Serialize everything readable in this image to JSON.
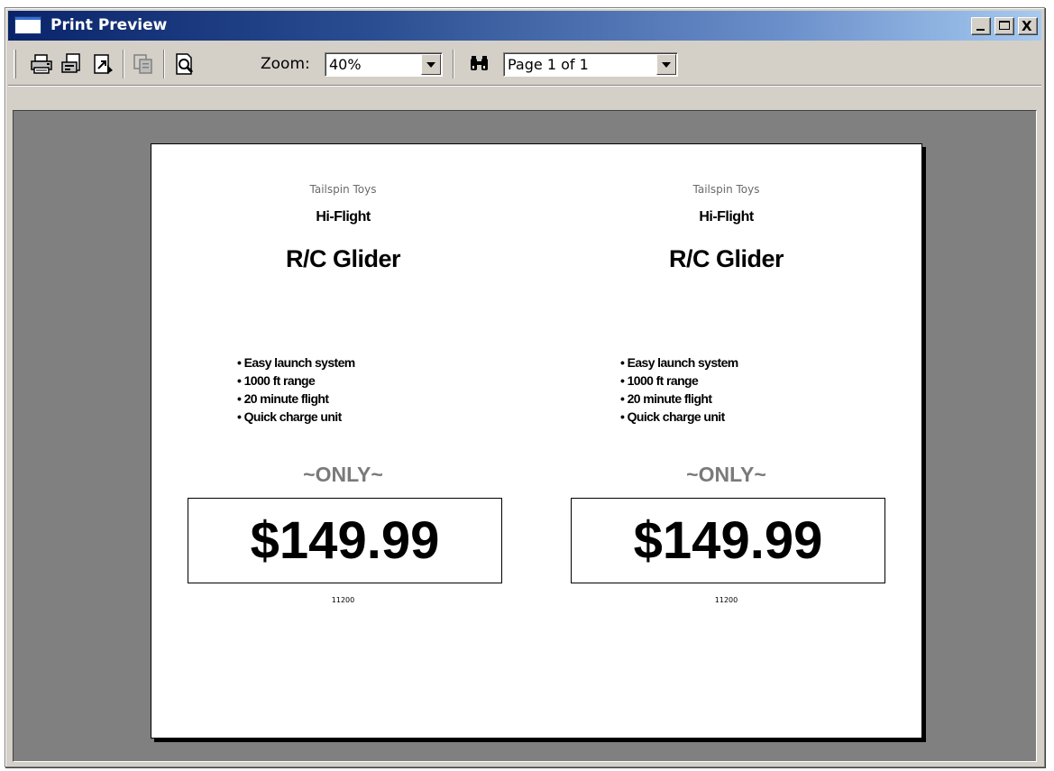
{
  "window": {
    "title": "Print Preview",
    "buttons": {
      "minimize": "_",
      "maximize": "□",
      "close": "X"
    }
  },
  "toolbar": {
    "icons": [
      "printer-icon",
      "page-setup-icon",
      "export-icon",
      "copy-icon",
      "preview-icon",
      "find-icon"
    ],
    "zoom_label": "Zoom:",
    "zoom_value": "40%",
    "page_value": "Page 1 of 1"
  },
  "page": {
    "signs": [
      {
        "brand": "Tailspin Toys",
        "product_line": "Hi-Flight",
        "product_name": "R/C Glider",
        "features": [
          "• Easy launch system",
          "• 1000 ft range",
          "• 20 minute flight",
          "• Quick charge unit"
        ],
        "only": "~ONLY~",
        "price": "$149.99",
        "code": "11200"
      },
      {
        "brand": "Tailspin Toys",
        "product_line": "Hi-Flight",
        "product_name": "R/C Glider",
        "features": [
          "• Easy launch system",
          "• 1000 ft range",
          "• 20 minute flight",
          "• Quick charge unit"
        ],
        "only": "~ONLY~",
        "price": "$149.99",
        "code": "11200"
      }
    ]
  },
  "colors": {
    "title_gradient_start": "#0a246a",
    "title_gradient_end": "#a6caf0",
    "chrome": "#d4d0c8",
    "viewport_background": "#808080",
    "only_text": "#7a7a7a"
  }
}
